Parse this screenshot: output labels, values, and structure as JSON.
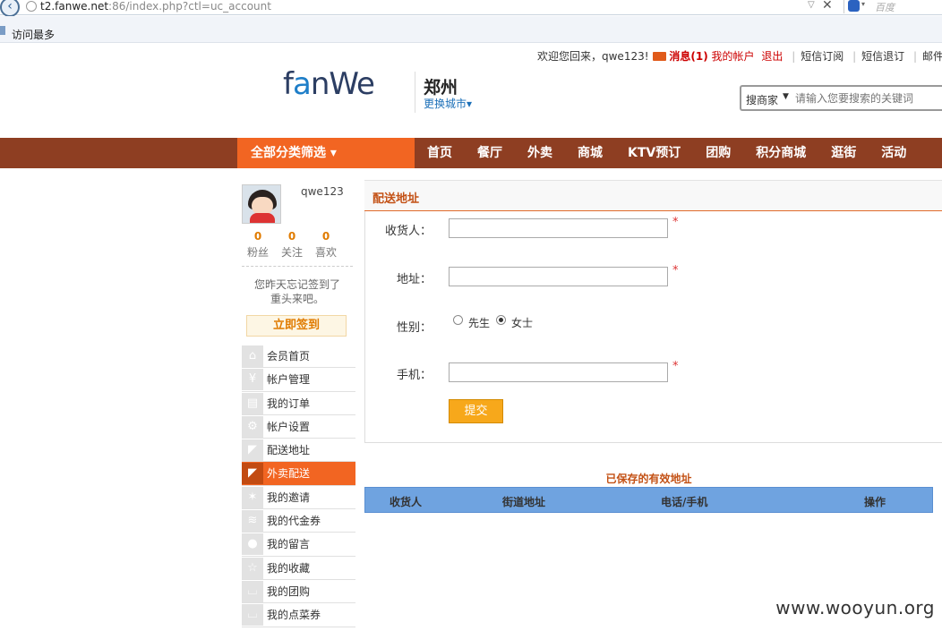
{
  "browser": {
    "url_host": "t2.fanwe.net",
    "url_rest": ":86/index.php?ctl=uc_account",
    "search_engine": "百度",
    "bookmark": "访问最多"
  },
  "toplinks": {
    "welcome": "欢迎您回来，qwe123!",
    "messages": "消息(1)",
    "my_account": "我的帐户",
    "logout": "退出",
    "sms_subscribe": "短信订阅",
    "sms_unsubscribe": "短信退订",
    "mail_subscribe": "邮件订"
  },
  "header": {
    "logo_part1": "f",
    "logo_part2": "a",
    "logo_part3": "nWe",
    "city": "郑州",
    "change_city": "更换城市▾",
    "search_type": "搜商家",
    "search_placeholder": "请输入您要搜索的关键词"
  },
  "nav": {
    "all_categories": "全部分类筛选 ▾",
    "items": [
      "首页",
      "餐厅",
      "外卖",
      "商城",
      "KTV预订",
      "团购",
      "积分商城",
      "逛街",
      "活动"
    ]
  },
  "sidebar": {
    "username": "qwe123",
    "stats": [
      {
        "num": "0",
        "label": "粉丝"
      },
      {
        "num": "0",
        "label": "关注"
      },
      {
        "num": "0",
        "label": "喜欢"
      }
    ],
    "checkin_line1": "您昨天忘记签到了",
    "checkin_line2": "重头来吧。",
    "checkin_button": "立即签到",
    "menu": [
      {
        "label": "会员首页",
        "icon": "⌂"
      },
      {
        "label": "帐户管理",
        "icon": "¥"
      },
      {
        "label": "我的订单",
        "icon": "▤"
      },
      {
        "label": "帐户设置",
        "icon": "⚙"
      },
      {
        "label": "配送地址",
        "icon": "◤"
      },
      {
        "label": "外卖配送",
        "icon": "◤"
      },
      {
        "label": "我的邀请",
        "icon": "✶"
      },
      {
        "label": "我的代金券",
        "icon": "≋"
      },
      {
        "label": "我的留言",
        "icon": "●"
      },
      {
        "label": "我的收藏",
        "icon": "☆"
      },
      {
        "label": "我的团购",
        "icon": "⌴"
      },
      {
        "label": "我的点菜券",
        "icon": "⌴"
      }
    ]
  },
  "form": {
    "title": "配送地址",
    "receiver_label": "收货人：",
    "address_label": "地址：",
    "gender_label": "性别：",
    "gender_male": "先生",
    "gender_female": "女士",
    "phone_label": "手机：",
    "required": "*",
    "submit": "提交"
  },
  "saved": {
    "title": "已保存的有效地址",
    "columns": [
      "收货人",
      "街道地址",
      "电话/手机",
      "操作"
    ]
  },
  "watermark": "www.wooyun.org"
}
